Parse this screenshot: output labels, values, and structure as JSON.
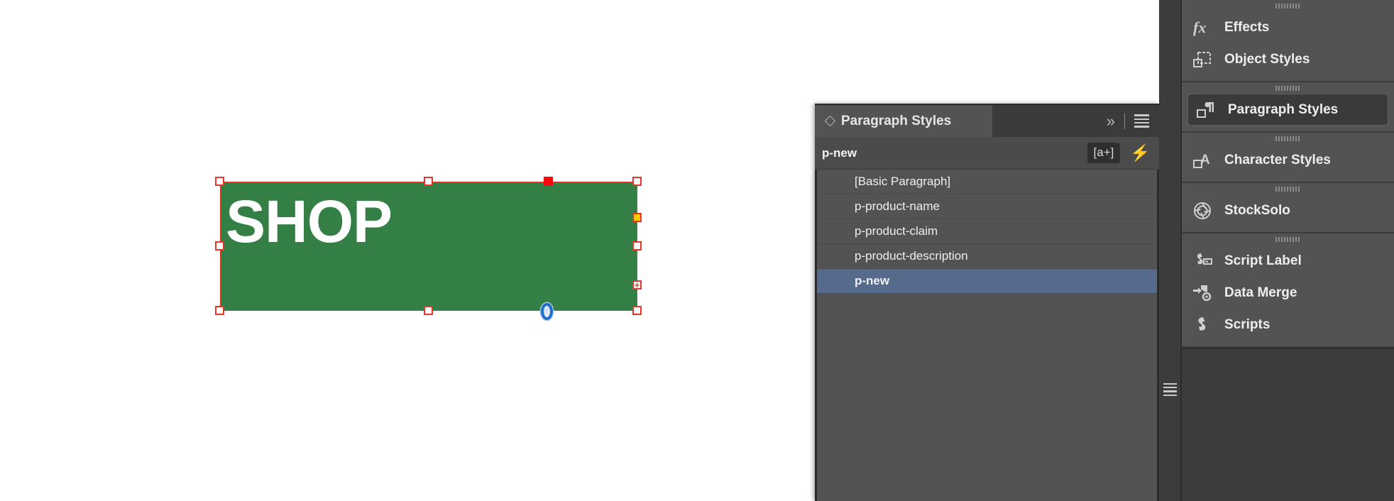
{
  "app": "Adobe InDesign",
  "canvas": {
    "text_frame": {
      "label": "SHOP",
      "fill_color": "#337F46",
      "text_color": "#FFFFFF",
      "selection_color": "#E8352A",
      "overset_indicator": "+",
      "out_port_color": "#FFCC00",
      "anchor_marker_color": "#F70C0C"
    }
  },
  "paragraph_styles_panel": {
    "tab_title": "Paragraph Styles",
    "collapse_icon": "chevron-double-right-icon",
    "menu_icon": "panel-menu-icon",
    "current_style": "p-new",
    "new_style_button": "[a+]",
    "quick_apply_button": "⚡",
    "styles": [
      {
        "name": "[Basic Paragraph]",
        "selected": false
      },
      {
        "name": "p-product-name",
        "selected": false
      },
      {
        "name": "p-product-claim",
        "selected": false
      },
      {
        "name": "p-product-description",
        "selected": false
      },
      {
        "name": "p-new",
        "selected": true
      }
    ],
    "selection_color": "#566B8C",
    "background_color": "#535353"
  },
  "dock": {
    "rail_menu_icon": "hamburger-icon",
    "groups": [
      {
        "items": [
          {
            "label": "Effects",
            "icon": "fx-icon",
            "active": false
          },
          {
            "label": "Object Styles",
            "icon": "object-styles-icon",
            "active": false
          }
        ]
      },
      {
        "items": [
          {
            "label": "Paragraph Styles",
            "icon": "paragraph-styles-icon",
            "active": true
          }
        ]
      },
      {
        "items": [
          {
            "label": "Character Styles",
            "icon": "character-styles-icon",
            "active": false
          }
        ]
      },
      {
        "items": [
          {
            "label": "StockSolo",
            "icon": "stocksolo-aperture-icon",
            "active": false
          }
        ]
      },
      {
        "items": [
          {
            "label": "Script Label",
            "icon": "script-label-icon",
            "active": false
          },
          {
            "label": "Data Merge",
            "icon": "data-merge-icon",
            "active": false
          },
          {
            "label": "Scripts",
            "icon": "scripts-icon",
            "active": false
          }
        ]
      }
    ]
  }
}
